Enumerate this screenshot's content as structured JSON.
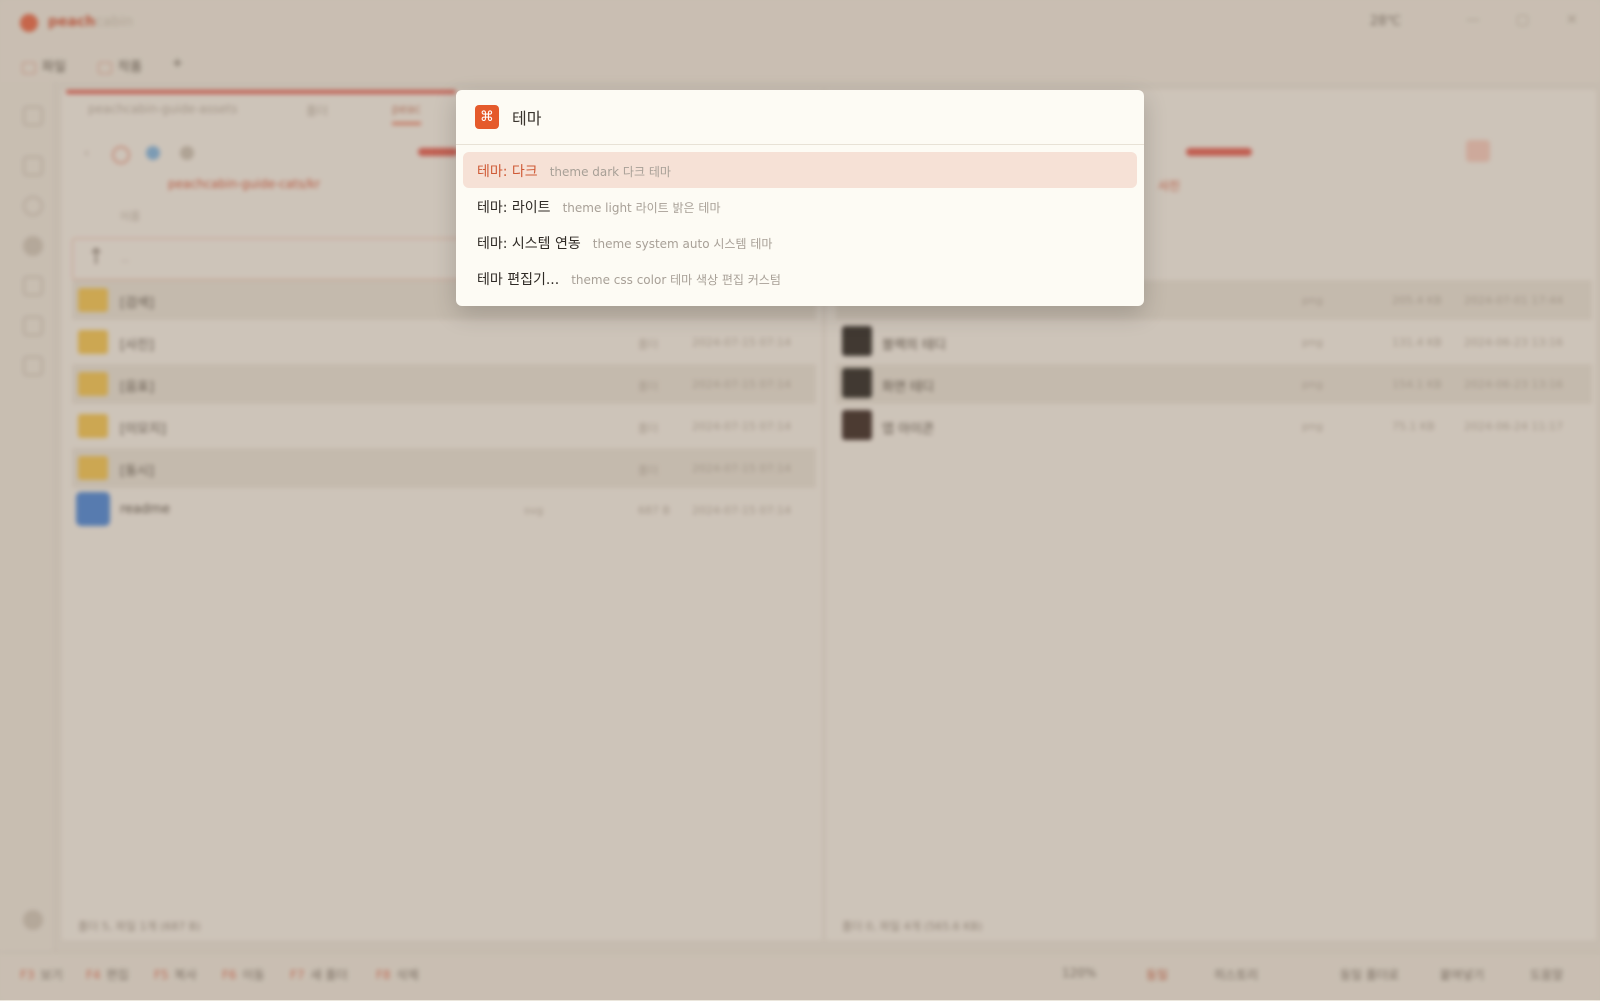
{
  "app": {
    "name_brand": "peach",
    "name_rest": "cabin",
    "weather": "28℃"
  },
  "menu": {
    "items": [
      "파일",
      "작품"
    ],
    "more": "+"
  },
  "tabs": [
    "peachcabin-guide-assets",
    "폴더",
    "peac"
  ],
  "left_pane": {
    "breadcrumb": "peachcabin-guide-cats/kr",
    "header_name": "이름",
    "up_row": "..",
    "rows": [
      {
        "name": "[검색]",
        "kind": "",
        "size": "",
        "date": ""
      },
      {
        "name": "[사진]",
        "kind": "",
        "size": "폴더",
        "date": "2024-07-15 07:14"
      },
      {
        "name": "[음표]",
        "kind": "",
        "size": "폴더",
        "date": "2024-07-15 07:14"
      },
      {
        "name": "[이모지]",
        "kind": "",
        "size": "폴더",
        "date": "2024-07-15 07:14"
      },
      {
        "name": "[동시]",
        "kind": "",
        "size": "폴더",
        "date": "2024-07-15 07:14"
      },
      {
        "name": "readme",
        "kind": "svg",
        "size": "687 B",
        "date": "2024-07-15 07:14"
      }
    ],
    "status": "폴더 5, 파일 1개 (687 B)"
  },
  "right_pane": {
    "crumb": "사진",
    "rows": [
      {
        "name": "",
        "kind": "png",
        "size": "205.4 KB",
        "date": "2024-07-01 17:44"
      },
      {
        "name": "블랙의 테디",
        "kind": "png",
        "size": "131.4 KB",
        "date": "2024-06-23 13:16"
      },
      {
        "name": "화면 테디",
        "kind": "png",
        "size": "154.1 KB",
        "date": "2024-06-23 13:16"
      },
      {
        "name": "앱 아이콘",
        "kind": "png",
        "size": "75.1 KB",
        "date": "2024-06-24 11:17"
      }
    ],
    "status": "폴더 0, 파일 4개 (565.6 KB)"
  },
  "bottom_bar": {
    "fkeys": [
      {
        "key": "F3",
        "label": "보기"
      },
      {
        "key": "F4",
        "label": "편집"
      },
      {
        "key": "F5",
        "label": "복사"
      },
      {
        "key": "F6",
        "label": "이동"
      },
      {
        "key": "F7",
        "label": "새 폴더"
      },
      {
        "key": "F8",
        "label": "삭제"
      }
    ],
    "zoom": "120%",
    "right_items": [
      "동일",
      "히스토리",
      "동일 폴더로",
      "붙여넣기",
      "도움말"
    ]
  },
  "palette": {
    "icon": "⌘",
    "query": "테마",
    "commands": [
      {
        "label": "테마: 다크",
        "keywords": "theme dark 다크 테마",
        "selected": true
      },
      {
        "label": "테마: 라이트",
        "keywords": "theme light 라이트 밝은 테마",
        "selected": false
      },
      {
        "label": "테마: 시스템 연동",
        "keywords": "theme system auto 시스템 테마",
        "selected": false
      },
      {
        "label": "테마 편집기...",
        "keywords": "theme css color 테마 색상 편집 커스텀",
        "selected": false
      }
    ]
  },
  "colors": {
    "accent": "#e55a2b",
    "selected_bg": "#f6e1d6",
    "selected_text": "#cf5a36"
  }
}
